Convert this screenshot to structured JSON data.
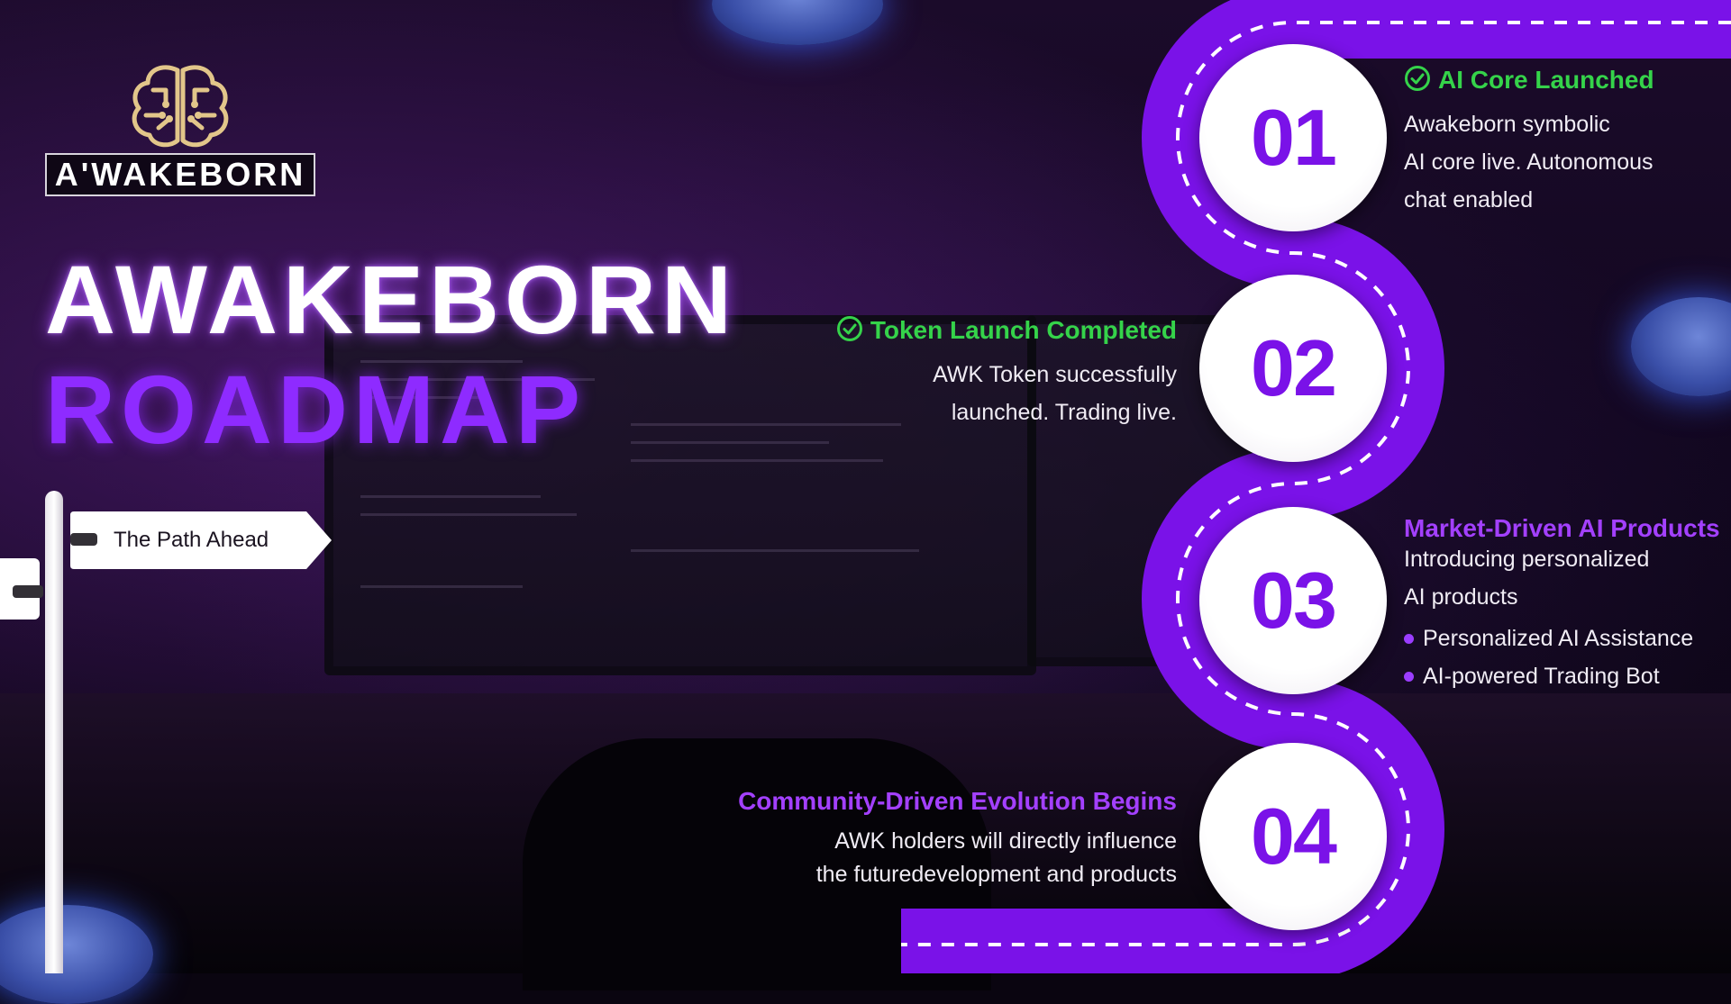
{
  "brand": {
    "logo_text": "A'WAKEBORN"
  },
  "hero": {
    "line1": "AWAKEBORN",
    "line2": "ROADMAP"
  },
  "sign": {
    "label": "The Path Ahead"
  },
  "colors": {
    "accent_purple": "#8e2bff",
    "done_green": "#35d34a",
    "bg": "#0a0510"
  },
  "milestones": [
    {
      "number": "01",
      "title": "AI Core Launched",
      "status": "completed",
      "desc_lines": [
        "Awakeborn symbolic",
        "AI core live. Autonomous",
        "chat enabled"
      ]
    },
    {
      "number": "02",
      "title": "Token Launch Completed",
      "status": "completed",
      "desc_lines": [
        "AWK Token successfully",
        "launched. Trading live."
      ]
    },
    {
      "number": "03",
      "title": "Market-Driven AI Products",
      "status": "upcoming",
      "desc_lines": [
        "Introducing personalized",
        "AI products"
      ],
      "bullets": [
        "Personalized AI Assistance",
        "AI-powered Trading Bot"
      ]
    },
    {
      "number": "04",
      "title": "Community-Driven Evolution Begins",
      "status": "upcoming",
      "desc_lines": [
        "AWK holders will directly influence",
        "the futuredevelopment and products"
      ]
    }
  ]
}
